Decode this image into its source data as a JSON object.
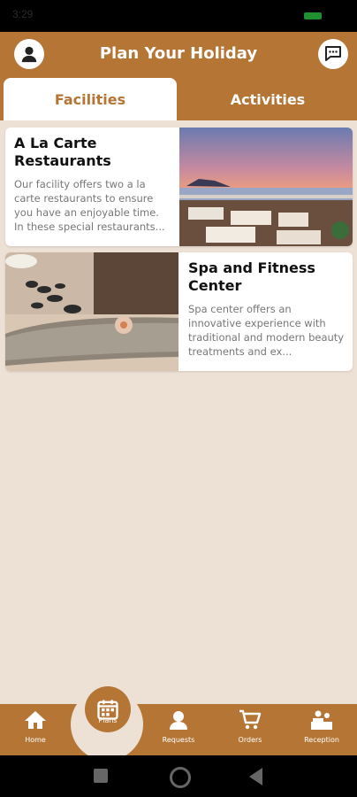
{
  "status": {
    "time": "3:29"
  },
  "header": {
    "title": "Plan Your Holiday",
    "icons": {
      "left": "profile-icon",
      "right": "chat-icon"
    }
  },
  "tabs": [
    {
      "label": "Facilities",
      "active": true
    },
    {
      "label": "Activities",
      "active": false
    }
  ],
  "cards": [
    {
      "title": "A La Carte Restaurants",
      "description": "Our facility offers two a la carte restaurants to ensure you have an enjoyable time. In these special restaurants..."
    },
    {
      "title": "Spa and Fitness Center",
      "description": "Spa center offers an innovative experience with traditional and modern beauty treatments and ex..."
    }
  ],
  "bottom_nav": [
    {
      "label": "Home",
      "icon": "home-icon"
    },
    {
      "label": "Plans",
      "icon": "calendar-icon"
    },
    {
      "label": "Requests",
      "icon": "requests-icon"
    },
    {
      "label": "Orders",
      "icon": "cart-icon"
    },
    {
      "label": "Reception",
      "icon": "reception-icon"
    }
  ],
  "colors": {
    "primary": "#b47535",
    "background": "#ede1d5",
    "card": "#ffffff",
    "inactive_text": "#ffffff"
  }
}
